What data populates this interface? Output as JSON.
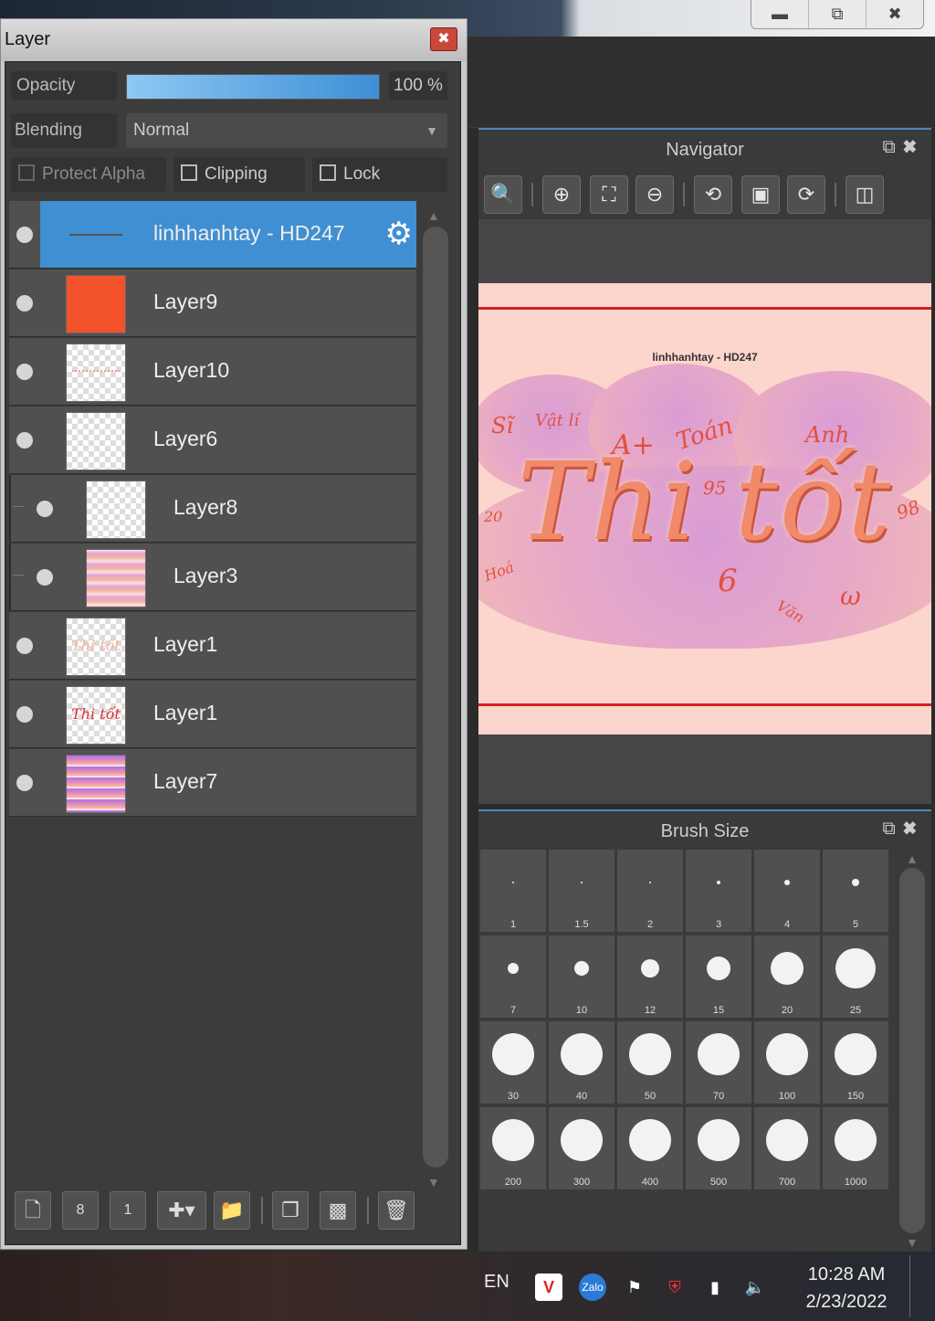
{
  "window": {
    "title_controls": [
      "minimize",
      "restore",
      "close"
    ]
  },
  "layer_panel": {
    "title": "Layer",
    "opacity_label": "Opacity",
    "opacity_value": "100 %",
    "opacity_fraction": 1.0,
    "blending_label": "Blending",
    "blending_value": "Normal",
    "protect_alpha_label": "Protect Alpha",
    "clipping_label": "Clipping",
    "lock_label": "Lock",
    "layers": [
      {
        "name": "linhhanhtay - HD247",
        "active": true,
        "thumb": "text-line"
      },
      {
        "name": "Layer9",
        "active": false,
        "thumb": "orange-fill"
      },
      {
        "name": "Layer10",
        "active": false,
        "thumb": "transparent-dots"
      },
      {
        "name": "Layer6",
        "active": false,
        "thumb": "transparent"
      },
      {
        "name": "Layer8",
        "active": false,
        "thumb": "transparent",
        "indented": true
      },
      {
        "name": "Layer3",
        "active": false,
        "thumb": "clouds",
        "indented": true
      },
      {
        "name": "Layer1",
        "active": false,
        "thumb": "text-pale"
      },
      {
        "name": "Layer1",
        "active": false,
        "thumb": "text-red"
      },
      {
        "name": "Layer7",
        "active": false,
        "thumb": "gradient-clouds"
      }
    ],
    "toolbar_icons": [
      "new-layer-icon",
      "new-8bit-layer-icon",
      "new-1bit-layer-icon",
      "add-layer-dropdown-icon",
      "folder-icon",
      "duplicate-icon",
      "merge-icon",
      "trash-icon"
    ]
  },
  "navigator": {
    "title": "Navigator",
    "tools": [
      "zoom-actual-icon",
      "zoom-in-icon",
      "fit-icon",
      "zoom-out-icon",
      "rotate-left-icon",
      "fullscreen-icon",
      "rotate-right-icon",
      "flip-icon"
    ],
    "canvas_caption": "linhhanhtay - HD247",
    "canvas_title": "Thi tốt",
    "doodles": [
      "Vật lí",
      "A+",
      "Toán",
      "Anh",
      "95",
      "98",
      "20",
      "Hoá",
      "Văn",
      "6",
      "ω",
      "Sĩ"
    ]
  },
  "brush_size": {
    "title": "Brush Size",
    "sizes": [
      "1",
      "1.5",
      "2",
      "3",
      "4",
      "5",
      "7",
      "10",
      "12",
      "15",
      "20",
      "25",
      "30",
      "40",
      "50",
      "70",
      "100",
      "150",
      "200",
      "300",
      "400",
      "500",
      "700",
      "1000"
    ]
  },
  "taskbar": {
    "language": "EN",
    "time": "10:28 AM",
    "date": "2/23/2022"
  },
  "colors": {
    "accent": "#3f8fd2",
    "panel": "#3c3c3c",
    "canvas_bg": "#fcd6cc",
    "text_red": "#e2503c"
  }
}
